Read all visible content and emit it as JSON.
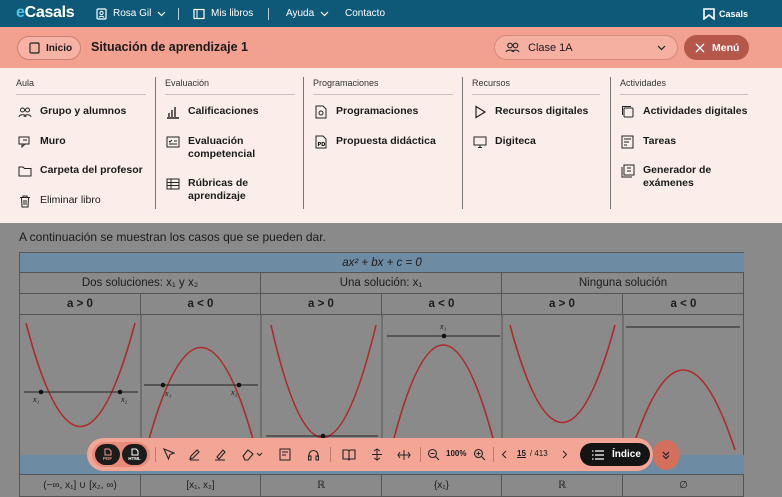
{
  "topbar": {
    "logo_e": "e",
    "logo_rest": "Casals",
    "user": "Rosa Gil",
    "books": "Mis libros",
    "help": "Ayuda",
    "contact": "Contacto",
    "brand": "Casals"
  },
  "secbar": {
    "home": "Inicio",
    "title": "Situación de aprendizaje 1",
    "class": "Clase 1A",
    "menu": "Menú"
  },
  "mega": {
    "aula": {
      "head": "Aula",
      "items": [
        "Grupo y alumnos",
        "Muro",
        "Carpeta del profesor",
        "Eliminar libro"
      ]
    },
    "evaluacion": {
      "head": "Evaluación",
      "items": [
        "Calificaciones",
        "Evaluación competencial",
        "Rúbricas de aprendizaje"
      ]
    },
    "programaciones": {
      "head": "Programaciones",
      "items": [
        "Programaciones",
        "Propuesta didáctica"
      ]
    },
    "recursos": {
      "head": "Recursos",
      "items": [
        "Recursos digitales",
        "Digiteca"
      ]
    },
    "actividades": {
      "head": "Actividades",
      "items": [
        "Actividades digitales",
        "Tareas",
        "Generador de exámenes"
      ]
    }
  },
  "doc": {
    "intro": "A continuación se muestran los casos que se pueden dar.",
    "equation": "ax² + bx + c = 0",
    "groups": [
      "Dos soluciones: x₁ y x₂",
      "Una solución: x₁",
      "Ninguna solución"
    ],
    "signs": [
      "a > 0",
      "a < 0",
      "a > 0",
      "a < 0",
      "a > 0",
      "a < 0"
    ],
    "graph_labels": {
      "x1": "x₁",
      "x2": "x₂"
    },
    "bottom": [
      "(−∞, x₁] ∪ [x₂, ∞)",
      "[x₁, x₂]",
      "ℝ",
      "{x₁}",
      "ℝ",
      "∅"
    ]
  },
  "toolbar": {
    "pdf": "PDF",
    "html": "HTML",
    "zoom": "100%",
    "page": "15",
    "total": "/ 413",
    "index": "Índice"
  }
}
